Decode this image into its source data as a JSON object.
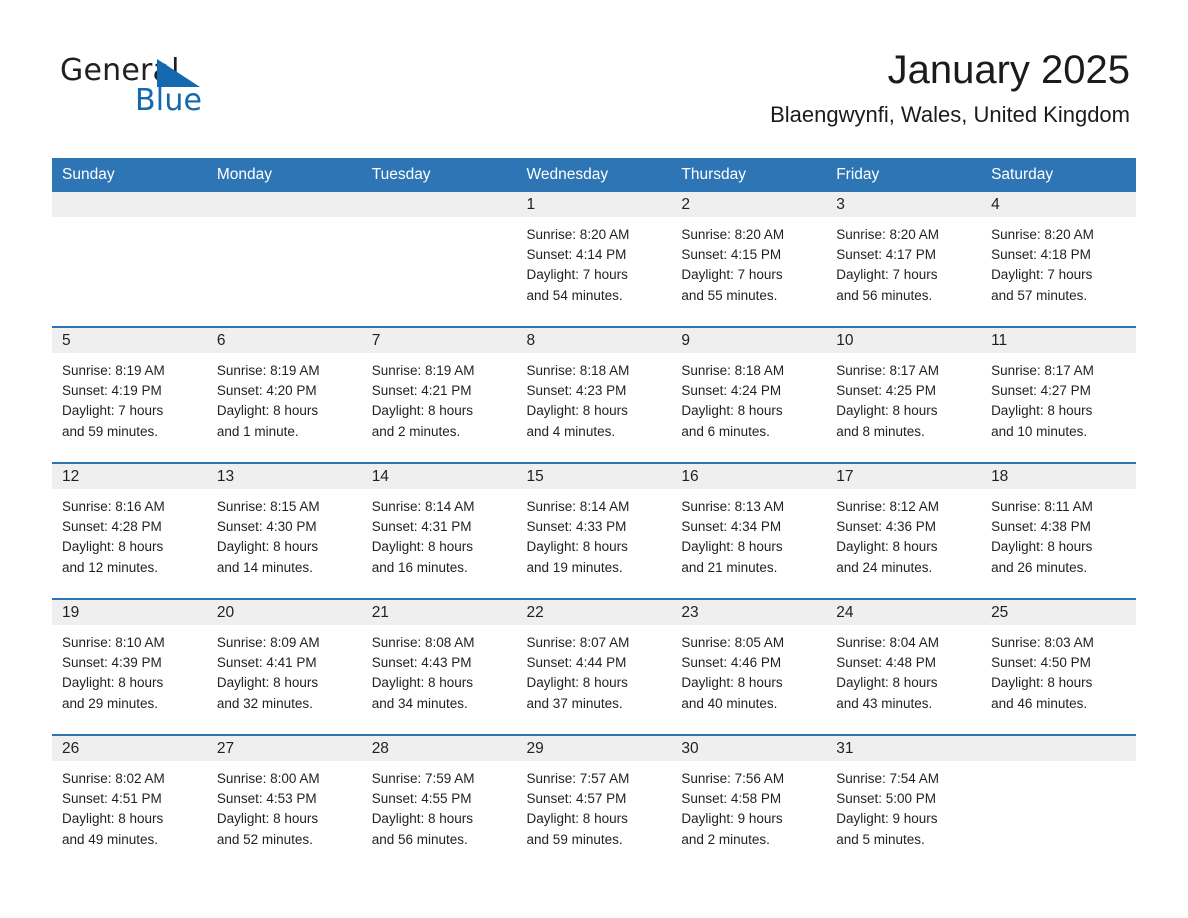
{
  "brand": {
    "word1": "General",
    "word2": "Blue",
    "triangle_color": "#1368b0",
    "logo_icon": "general-blue-triangle-logo"
  },
  "header": {
    "title": "January 2025",
    "location": "Blaengwynfi, Wales, United Kingdom"
  },
  "theme": {
    "header_blue": "#2e75b6",
    "daynum_gray": "#efefef",
    "text_dark": "#231f20",
    "brand_blue": "#1368b0"
  },
  "weekday_headers": [
    "Sunday",
    "Monday",
    "Tuesday",
    "Wednesday",
    "Thursday",
    "Friday",
    "Saturday"
  ],
  "weeks": [
    [
      {
        "day": "",
        "lines": []
      },
      {
        "day": "",
        "lines": []
      },
      {
        "day": "",
        "lines": []
      },
      {
        "day": "1",
        "lines": [
          "Sunrise: 8:20 AM",
          "Sunset: 4:14 PM",
          "Daylight: 7 hours",
          "and 54 minutes."
        ]
      },
      {
        "day": "2",
        "lines": [
          "Sunrise: 8:20 AM",
          "Sunset: 4:15 PM",
          "Daylight: 7 hours",
          "and 55 minutes."
        ]
      },
      {
        "day": "3",
        "lines": [
          "Sunrise: 8:20 AM",
          "Sunset: 4:17 PM",
          "Daylight: 7 hours",
          "and 56 minutes."
        ]
      },
      {
        "day": "4",
        "lines": [
          "Sunrise: 8:20 AM",
          "Sunset: 4:18 PM",
          "Daylight: 7 hours",
          "and 57 minutes."
        ]
      }
    ],
    [
      {
        "day": "5",
        "lines": [
          "Sunrise: 8:19 AM",
          "Sunset: 4:19 PM",
          "Daylight: 7 hours",
          "and 59 minutes."
        ]
      },
      {
        "day": "6",
        "lines": [
          "Sunrise: 8:19 AM",
          "Sunset: 4:20 PM",
          "Daylight: 8 hours",
          "and 1 minute."
        ]
      },
      {
        "day": "7",
        "lines": [
          "Sunrise: 8:19 AM",
          "Sunset: 4:21 PM",
          "Daylight: 8 hours",
          "and 2 minutes."
        ]
      },
      {
        "day": "8",
        "lines": [
          "Sunrise: 8:18 AM",
          "Sunset: 4:23 PM",
          "Daylight: 8 hours",
          "and 4 minutes."
        ]
      },
      {
        "day": "9",
        "lines": [
          "Sunrise: 8:18 AM",
          "Sunset: 4:24 PM",
          "Daylight: 8 hours",
          "and 6 minutes."
        ]
      },
      {
        "day": "10",
        "lines": [
          "Sunrise: 8:17 AM",
          "Sunset: 4:25 PM",
          "Daylight: 8 hours",
          "and 8 minutes."
        ]
      },
      {
        "day": "11",
        "lines": [
          "Sunrise: 8:17 AM",
          "Sunset: 4:27 PM",
          "Daylight: 8 hours",
          "and 10 minutes."
        ]
      }
    ],
    [
      {
        "day": "12",
        "lines": [
          "Sunrise: 8:16 AM",
          "Sunset: 4:28 PM",
          "Daylight: 8 hours",
          "and 12 minutes."
        ]
      },
      {
        "day": "13",
        "lines": [
          "Sunrise: 8:15 AM",
          "Sunset: 4:30 PM",
          "Daylight: 8 hours",
          "and 14 minutes."
        ]
      },
      {
        "day": "14",
        "lines": [
          "Sunrise: 8:14 AM",
          "Sunset: 4:31 PM",
          "Daylight: 8 hours",
          "and 16 minutes."
        ]
      },
      {
        "day": "15",
        "lines": [
          "Sunrise: 8:14 AM",
          "Sunset: 4:33 PM",
          "Daylight: 8 hours",
          "and 19 minutes."
        ]
      },
      {
        "day": "16",
        "lines": [
          "Sunrise: 8:13 AM",
          "Sunset: 4:34 PM",
          "Daylight: 8 hours",
          "and 21 minutes."
        ]
      },
      {
        "day": "17",
        "lines": [
          "Sunrise: 8:12 AM",
          "Sunset: 4:36 PM",
          "Daylight: 8 hours",
          "and 24 minutes."
        ]
      },
      {
        "day": "18",
        "lines": [
          "Sunrise: 8:11 AM",
          "Sunset: 4:38 PM",
          "Daylight: 8 hours",
          "and 26 minutes."
        ]
      }
    ],
    [
      {
        "day": "19",
        "lines": [
          "Sunrise: 8:10 AM",
          "Sunset: 4:39 PM",
          "Daylight: 8 hours",
          "and 29 minutes."
        ]
      },
      {
        "day": "20",
        "lines": [
          "Sunrise: 8:09 AM",
          "Sunset: 4:41 PM",
          "Daylight: 8 hours",
          "and 32 minutes."
        ]
      },
      {
        "day": "21",
        "lines": [
          "Sunrise: 8:08 AM",
          "Sunset: 4:43 PM",
          "Daylight: 8 hours",
          "and 34 minutes."
        ]
      },
      {
        "day": "22",
        "lines": [
          "Sunrise: 8:07 AM",
          "Sunset: 4:44 PM",
          "Daylight: 8 hours",
          "and 37 minutes."
        ]
      },
      {
        "day": "23",
        "lines": [
          "Sunrise: 8:05 AM",
          "Sunset: 4:46 PM",
          "Daylight: 8 hours",
          "and 40 minutes."
        ]
      },
      {
        "day": "24",
        "lines": [
          "Sunrise: 8:04 AM",
          "Sunset: 4:48 PM",
          "Daylight: 8 hours",
          "and 43 minutes."
        ]
      },
      {
        "day": "25",
        "lines": [
          "Sunrise: 8:03 AM",
          "Sunset: 4:50 PM",
          "Daylight: 8 hours",
          "and 46 minutes."
        ]
      }
    ],
    [
      {
        "day": "26",
        "lines": [
          "Sunrise: 8:02 AM",
          "Sunset: 4:51 PM",
          "Daylight: 8 hours",
          "and 49 minutes."
        ]
      },
      {
        "day": "27",
        "lines": [
          "Sunrise: 8:00 AM",
          "Sunset: 4:53 PM",
          "Daylight: 8 hours",
          "and 52 minutes."
        ]
      },
      {
        "day": "28",
        "lines": [
          "Sunrise: 7:59 AM",
          "Sunset: 4:55 PM",
          "Daylight: 8 hours",
          "and 56 minutes."
        ]
      },
      {
        "day": "29",
        "lines": [
          "Sunrise: 7:57 AM",
          "Sunset: 4:57 PM",
          "Daylight: 8 hours",
          "and 59 minutes."
        ]
      },
      {
        "day": "30",
        "lines": [
          "Sunrise: 7:56 AM",
          "Sunset: 4:58 PM",
          "Daylight: 9 hours",
          "and 2 minutes."
        ]
      },
      {
        "day": "31",
        "lines": [
          "Sunrise: 7:54 AM",
          "Sunset: 5:00 PM",
          "Daylight: 9 hours",
          "and 5 minutes."
        ]
      },
      {
        "day": "",
        "lines": []
      }
    ]
  ]
}
